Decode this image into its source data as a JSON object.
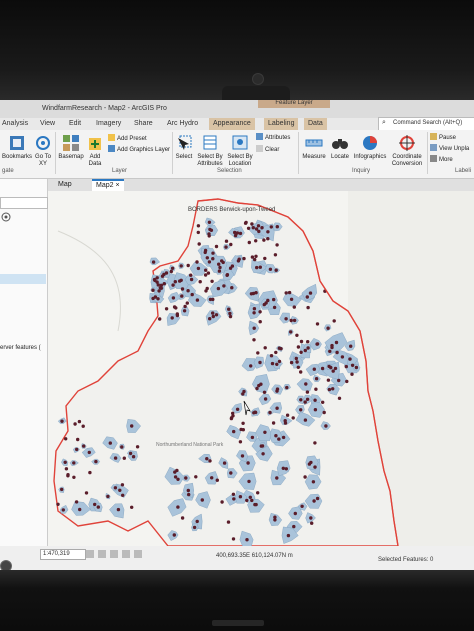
{
  "app": {
    "window_title": "WindfarmResearch - Map2 - ArcGIS Pro",
    "contextual_tab": "Feature Layer"
  },
  "ribbon_tabs": [
    "Analysis",
    "View",
    "Edit",
    "Imagery",
    "Share",
    "Arc Hydro",
    "Appearance",
    "Labeling",
    "Data"
  ],
  "command_search": {
    "placeholder": "Command Search (Alt+Q)"
  },
  "ribbon": {
    "navigate": {
      "bookmarks": "Bookmarks",
      "goto": "Go To XY",
      "group_label": "gate"
    },
    "layer": {
      "basemap": "Basemap",
      "add_data": "Add Data",
      "add_preset": "Add Preset",
      "add_graphics": "Add Graphics Layer",
      "group_label": "Layer"
    },
    "selection": {
      "select": "Select",
      "select_by_attributes": "Select By Attributes",
      "select_by_location": "Select By Location",
      "attributes": "Attributes",
      "clear": "Clear",
      "group_label": "Selection"
    },
    "inquiry": {
      "measure": "Measure",
      "locate": "Locate",
      "infographics": "Infographics",
      "coordinate_conversion": "Coordinate Conversion",
      "group_label": "Inquiry"
    },
    "labeling": {
      "pause": "Pause",
      "view_unplaced": "View Unpla",
      "more": "More",
      "group_label": "Labeli"
    }
  },
  "left_pane": {
    "server_text": "erver features ("
  },
  "map_tabs": [
    {
      "label": "Map",
      "active": false
    },
    {
      "label": "Map2",
      "active": true
    }
  ],
  "map": {
    "place_label": "BORDERS Berwick-upon-Tweed",
    "area_label": "Northumberland National Park"
  },
  "status": {
    "scale": "1:470,319",
    "coordinates": "400,693.35E 610,124.07N m",
    "selected_features": "Selected Features: 0"
  },
  "colors": {
    "polygon_fill": "#a9c3da",
    "point_marker": "#5a1d2a",
    "boundary": "#e0433a",
    "accent": "#2b78c2"
  }
}
